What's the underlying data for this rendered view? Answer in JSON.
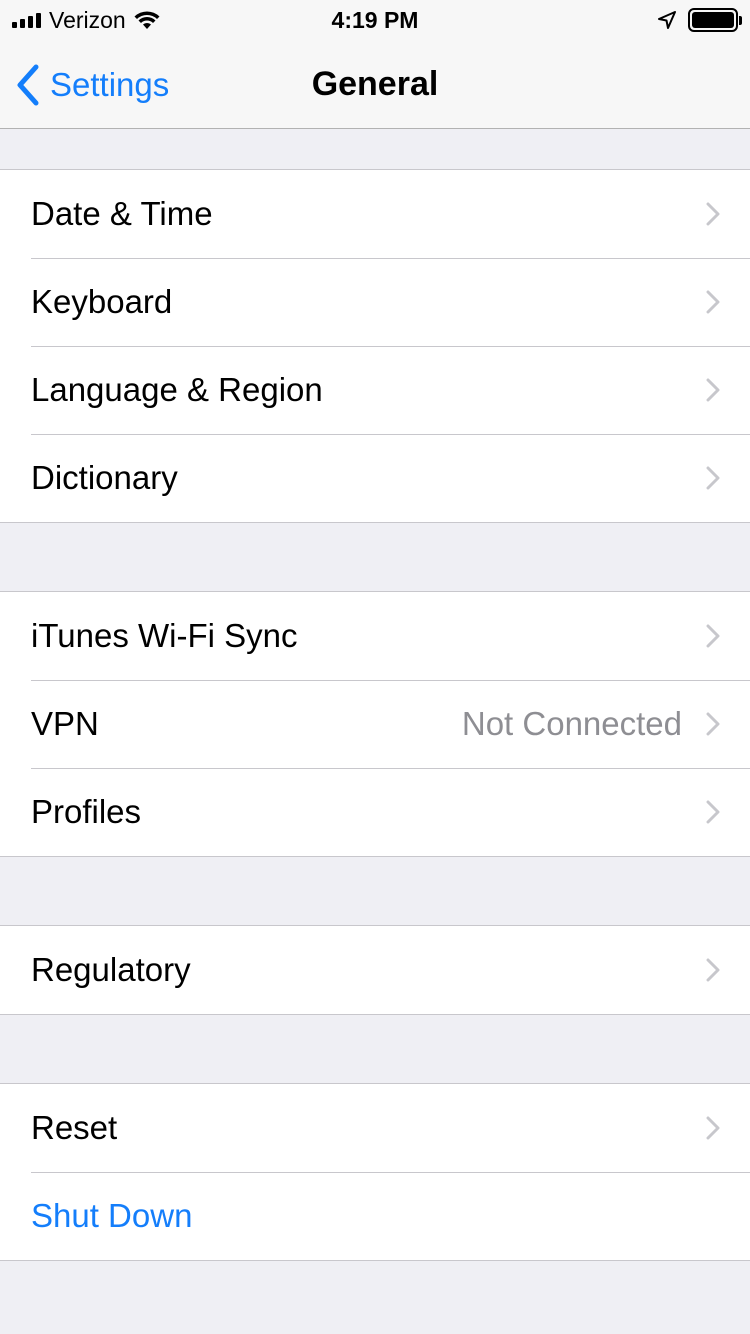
{
  "status_bar": {
    "carrier": "Verizon",
    "time": "4:19 PM"
  },
  "nav": {
    "back_label": "Settings",
    "title": "General"
  },
  "groups": [
    {
      "rows": [
        {
          "label": "Date & Time"
        },
        {
          "label": "Keyboard"
        },
        {
          "label": "Language & Region"
        },
        {
          "label": "Dictionary"
        }
      ]
    },
    {
      "rows": [
        {
          "label": "iTunes Wi-Fi Sync"
        },
        {
          "label": "VPN",
          "detail": "Not Connected"
        },
        {
          "label": "Profiles"
        }
      ]
    },
    {
      "rows": [
        {
          "label": "Regulatory"
        }
      ]
    },
    {
      "rows": [
        {
          "label": "Reset"
        },
        {
          "label": "Shut Down"
        }
      ]
    }
  ],
  "colors": {
    "accent": "#147efb",
    "background": "#efeff4",
    "separator": "#c8c7cc",
    "detail_text": "#8e8e93",
    "chevron": "#c7c7cc"
  },
  "icons": [
    "signal-bars-icon",
    "wifi-icon",
    "location-arrow-icon",
    "battery-icon",
    "back-chevron-icon",
    "chevron-right-icon"
  ]
}
